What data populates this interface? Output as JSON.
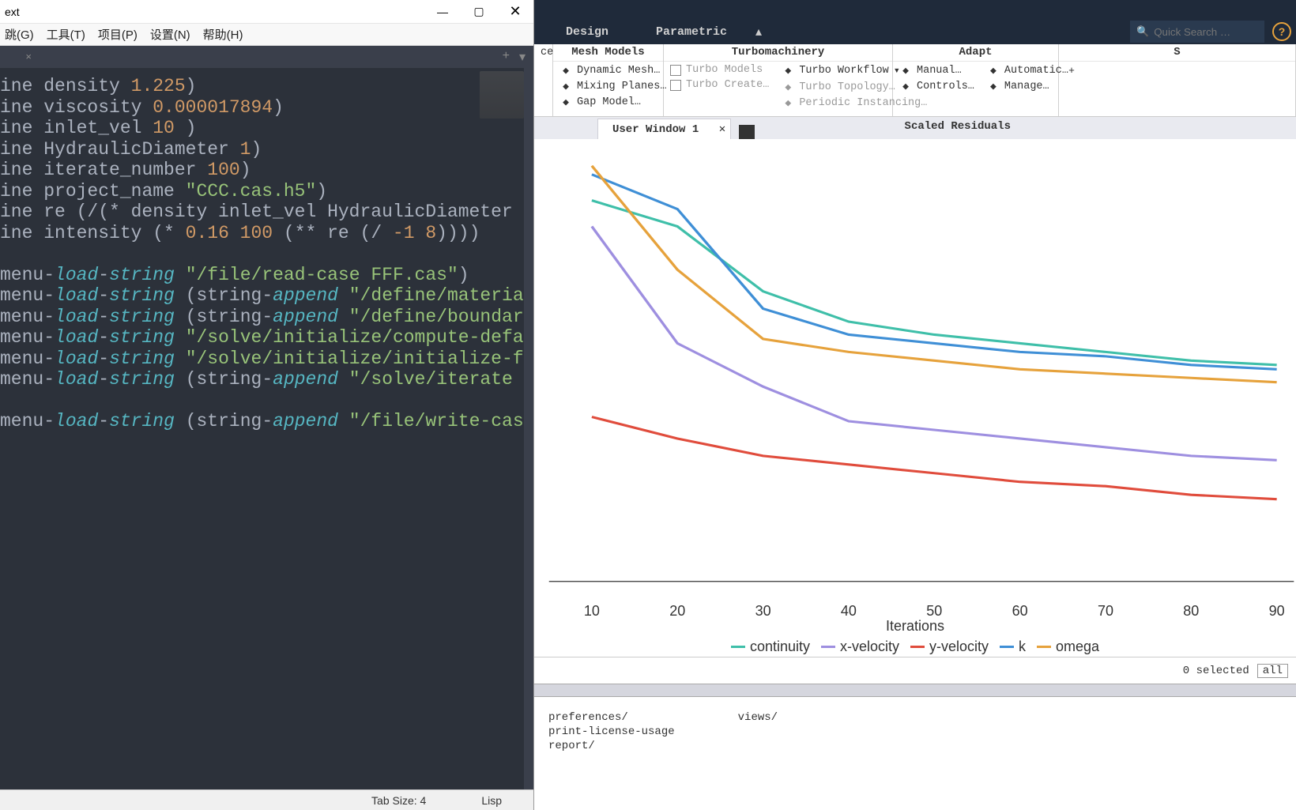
{
  "editor": {
    "title": "ext",
    "menu": [
      "跳(G)",
      "工具(T)",
      "项目(P)",
      "设置(N)",
      "帮助(H)"
    ],
    "status": {
      "tab_size": "Tab Size: 4",
      "syntax": "Lisp"
    },
    "code": [
      {
        "pre": "ine ",
        "id": "density ",
        "num": "1.225",
        "post": ")"
      },
      {
        "pre": "ine ",
        "id": "viscosity ",
        "num": "0.000017894",
        "post": ")"
      },
      {
        "pre": "ine ",
        "id": "inlet_vel ",
        "num": "10",
        "post": " )"
      },
      {
        "pre": "ine ",
        "id": "HydraulicDiameter ",
        "num": "1",
        "post": ")"
      },
      {
        "pre": "ine ",
        "id": "iterate_number ",
        "num": "100",
        "post": ")"
      },
      {
        "pre": "ine ",
        "id": "project_name ",
        "str": "\"CCC.cas.h5\"",
        "post": ")"
      },
      {
        "raw": "ine re (/(* density inlet_vel HydraulicDiameter )"
      },
      {
        "intensity": true,
        "pre": "ine ",
        "id": "intensity (* ",
        "n1": "0.16 ",
        "n2": "100",
        "mid": " (** re (/ ",
        "n3": "-1 ",
        "n4": "8",
        "post": "))))"
      },
      {
        "blank": true
      },
      {
        "tm": true,
        "arg": "\"/file/read-case FFF.cas\"",
        "post": ")"
      },
      {
        "tm": true,
        "sa": true,
        "arg": "\"/define/materials"
      },
      {
        "tm": true,
        "sa": true,
        "arg": "\"/define/boundary-"
      },
      {
        "tm": true,
        "arg": "\"/solve/initialize/compute-defaul"
      },
      {
        "tm": true,
        "arg": "\"/solve/initialize/initialize-flo"
      },
      {
        "tm": true,
        "sa": true,
        "arg": "\"/solve/iterate \""
      },
      {
        "blank": true
      },
      {
        "tm": true,
        "sa": true,
        "arg": "\"/file/write-case-"
      }
    ]
  },
  "fluent": {
    "tabs": [
      "Design",
      "Parametric"
    ],
    "search_placeholder": "Quick Search …",
    "ribbon": {
      "suffix_tab": "ces",
      "groups": [
        {
          "title": "Mesh Models",
          "items": [
            {
              "icon": "dyn",
              "label": "Dynamic Mesh…"
            },
            {
              "icon": "mix",
              "label": "Mixing Planes…"
            },
            {
              "icon": "gap",
              "label": "Gap Model…"
            }
          ]
        },
        {
          "title": "Turbomachinery",
          "cols": [
            [
              {
                "cb": true,
                "label": "Turbo Models",
                "dis": true
              },
              {
                "cb": true,
                "label": "Turbo Create…",
                "dis": true
              }
            ],
            [
              {
                "icon": "wf",
                "label": "Turbo Workflow",
                "dd": true
              },
              {
                "icon": "tt",
                "label": "Turbo Topology…",
                "dis": true
              },
              {
                "icon": "pi",
                "label": "Periodic Instancing…",
                "dis": true
              }
            ]
          ]
        },
        {
          "title": "Adapt",
          "cols": [
            [
              {
                "icon": "man",
                "label": "Manual…"
              },
              {
                "icon": "ctl",
                "label": "Controls…"
              }
            ],
            [
              {
                "icon": "auto",
                "label": "Automatic…"
              },
              {
                "icon": "mng",
                "label": "Manage…"
              }
            ]
          ]
        },
        {
          "title": "S",
          "items": [
            {
              "plus": true
            }
          ]
        }
      ]
    },
    "graphic": {
      "tab": "User Window 1",
      "title": "Scaled Residuals"
    },
    "footer": {
      "selected": "0 selected",
      "filter": "all"
    },
    "tui": {
      "col1": [
        "preferences/",
        "print-license-usage",
        "report/"
      ],
      "col2": [
        "views/"
      ]
    }
  },
  "chart_data": {
    "type": "line",
    "xlabel": "Iterations",
    "x": [
      10,
      20,
      30,
      40,
      50,
      60,
      70,
      80,
      90
    ],
    "xlim": [
      5,
      92
    ],
    "ylim": [
      0,
      1
    ],
    "series": [
      {
        "name": "continuity",
        "color": "#3fbfa9",
        "values": [
          0.88,
          0.82,
          0.67,
          0.6,
          0.57,
          0.55,
          0.53,
          0.51,
          0.5
        ]
      },
      {
        "name": "x-velocity",
        "color": "#9e8fe0",
        "values": [
          0.82,
          0.55,
          0.45,
          0.37,
          0.35,
          0.33,
          0.31,
          0.29,
          0.28
        ]
      },
      {
        "name": "y-velocity",
        "color": "#e04c3c",
        "values": [
          0.38,
          0.33,
          0.29,
          0.27,
          0.25,
          0.23,
          0.22,
          0.2,
          0.19
        ]
      },
      {
        "name": "k",
        "color": "#3f8fd6",
        "values": [
          0.94,
          0.86,
          0.63,
          0.57,
          0.55,
          0.53,
          0.52,
          0.5,
          0.49
        ]
      },
      {
        "name": "omega",
        "color": "#e6a23c",
        "values": [
          0.96,
          0.72,
          0.56,
          0.53,
          0.51,
          0.49,
          0.48,
          0.47,
          0.46
        ]
      }
    ],
    "legend": [
      "continuity",
      "x-velocity",
      "y-velocity",
      "k",
      "omega"
    ]
  }
}
